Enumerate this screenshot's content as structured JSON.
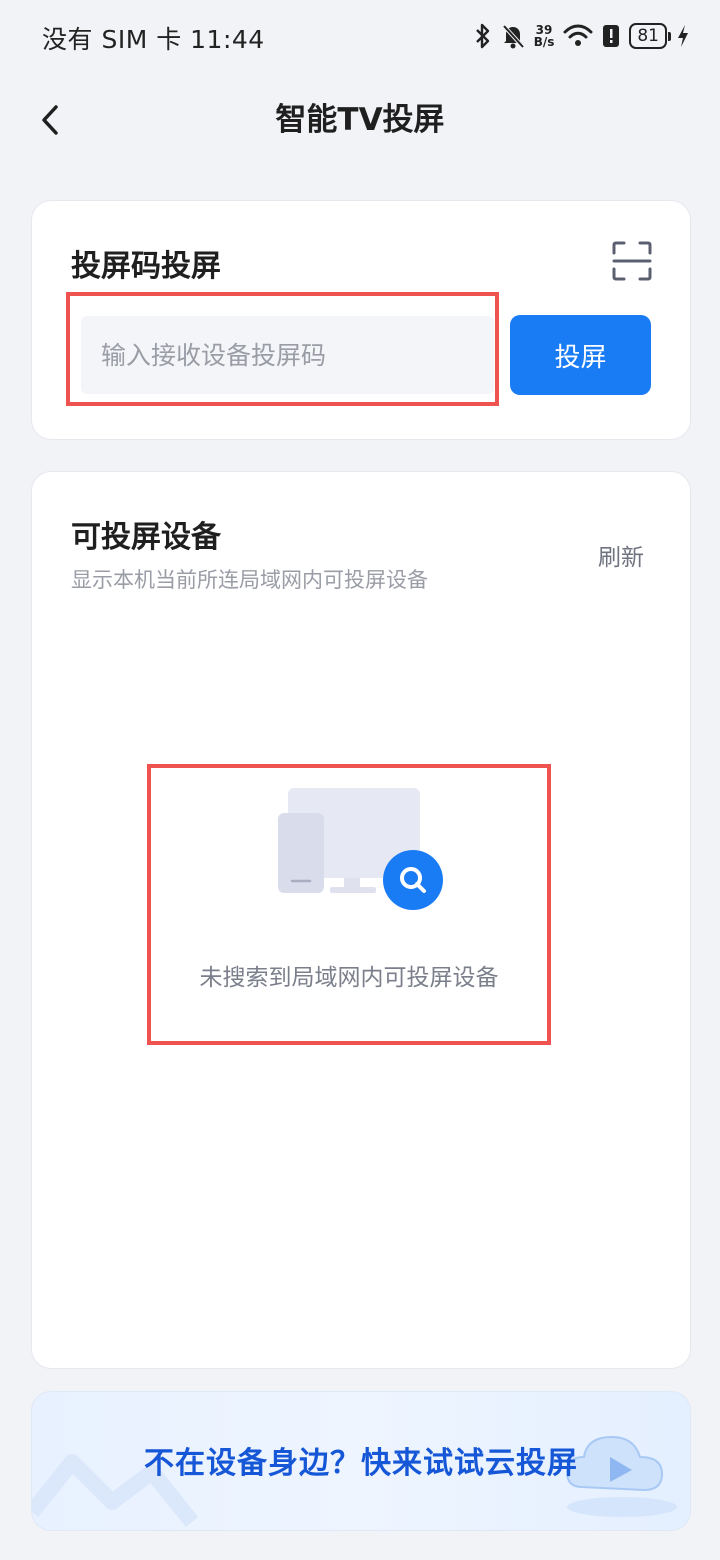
{
  "status_bar": {
    "carrier_time": "没有 SIM 卡 11:44",
    "net_speed_value": "39",
    "net_speed_unit": "B/s",
    "battery": "81",
    "icons": [
      "bluetooth-icon",
      "mute-bell-icon",
      "wifi-icon",
      "alert-icon",
      "battery-icon",
      "charging-icon"
    ]
  },
  "header": {
    "title": "智能TV投屏",
    "back_icon": "chevron-left-icon"
  },
  "code_cast": {
    "title": "投屏码投屏",
    "input_placeholder": "输入接收设备投屏码",
    "input_value": "",
    "button_label": "投屏",
    "scan_icon": "scan-icon"
  },
  "devices": {
    "title": "可投屏设备",
    "subtitle": "显示本机当前所连局域网内可投屏设备",
    "refresh_label": "刷新",
    "empty_text": "未搜索到局域网内可投屏设备",
    "empty_icon": "tv-search-icon"
  },
  "banner": {
    "text": "不在设备身边？快来试试云投屏",
    "icon": "cloud-cast-icon"
  },
  "colors": {
    "accent": "#1a7cf5",
    "highlight": "#ef5350",
    "banner_text": "#1557d6",
    "background": "#f2f3f7"
  }
}
